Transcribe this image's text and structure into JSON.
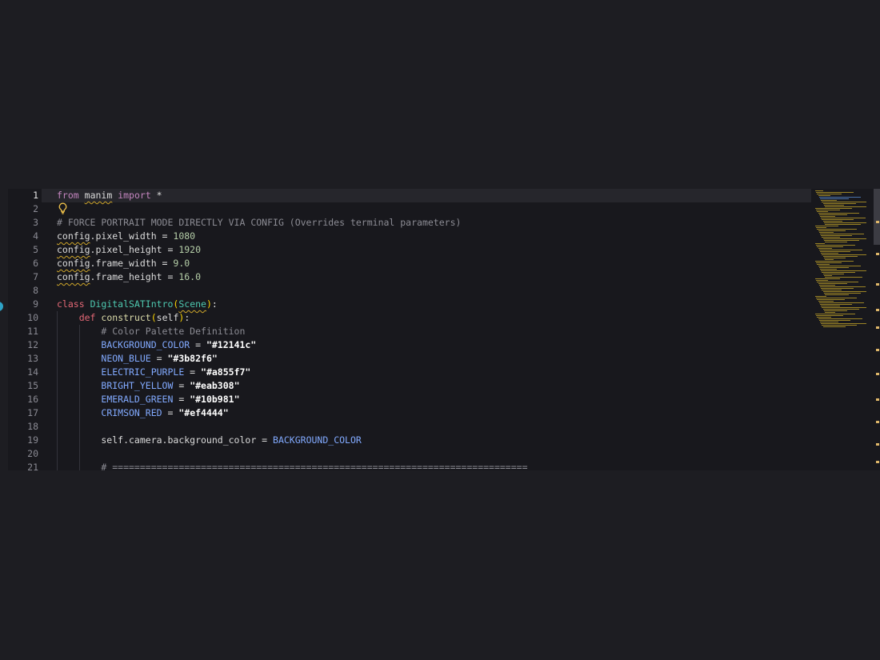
{
  "editor": {
    "active_line": 1,
    "lines": [
      {
        "n": "1",
        "t": "from manim import *"
      },
      {
        "n": "2",
        "t": ""
      },
      {
        "n": "3",
        "t": "# FORCE PORTRAIT MODE DIRECTLY VIA CONFIG (Overrides terminal parameters)"
      },
      {
        "n": "4",
        "t": "config.pixel_width = 1080"
      },
      {
        "n": "5",
        "t": "config.pixel_height = 1920"
      },
      {
        "n": "6",
        "t": "config.frame_width = 9.0"
      },
      {
        "n": "7",
        "t": "config.frame_height = 16.0"
      },
      {
        "n": "8",
        "t": ""
      },
      {
        "n": "9",
        "t": "class DigitalSATIntro(Scene):"
      },
      {
        "n": "10",
        "t": "    def construct(self):"
      },
      {
        "n": "11",
        "t": "        # Color Palette Definition"
      },
      {
        "n": "12",
        "t": "        BACKGROUND_COLOR = \"#12141c\""
      },
      {
        "n": "13",
        "t": "        NEON_BLUE = \"#3b82f6\""
      },
      {
        "n": "14",
        "t": "        ELECTRIC_PURPLE = \"#a855f7\""
      },
      {
        "n": "15",
        "t": "        BRIGHT_YELLOW = \"#eab308\""
      },
      {
        "n": "16",
        "t": "        EMERALD_GREEN = \"#10b981\""
      },
      {
        "n": "17",
        "t": "        CRIMSON_RED = \"#ef4444\""
      },
      {
        "n": "18",
        "t": ""
      },
      {
        "n": "19",
        "t": "        self.camera.background_color = BACKGROUND_COLOR"
      },
      {
        "n": "20",
        "t": ""
      },
      {
        "n": "21",
        "t": "        # ==========================================================================="
      }
    ]
  },
  "icons": {
    "lightbulb": "lightbulb-icon",
    "breakpoint": "breakpoint-marker"
  },
  "colors": {
    "background": "#1d1d22",
    "editor_bg": "#18181d",
    "keyword": "#c586c0",
    "def_keyword": "#e46876",
    "class_name": "#4ec9b0",
    "number": "#b5cea8",
    "constant": "#82aaff",
    "comment": "#8c8c94",
    "squiggle": "#d0a72a"
  }
}
